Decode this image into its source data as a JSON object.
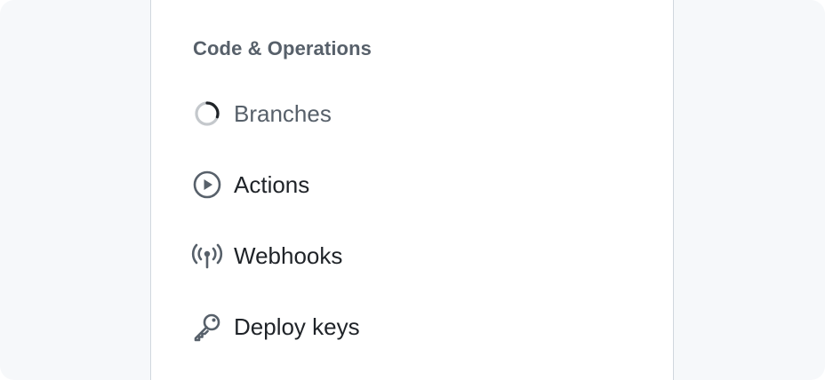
{
  "section": {
    "title": "Code & Operations"
  },
  "items": [
    {
      "label": "Branches",
      "icon": "loading-spinner-icon",
      "state": "loading"
    },
    {
      "label": "Actions",
      "icon": "play-circle-icon"
    },
    {
      "label": "Webhooks",
      "icon": "broadcast-icon"
    },
    {
      "label": "Deploy keys",
      "icon": "key-icon"
    }
  ],
  "colors": {
    "background": "#f6f8fa",
    "panel": "#ffffff",
    "border": "#d0d7de",
    "text_primary": "#1f2328",
    "text_muted": "#57606a"
  }
}
